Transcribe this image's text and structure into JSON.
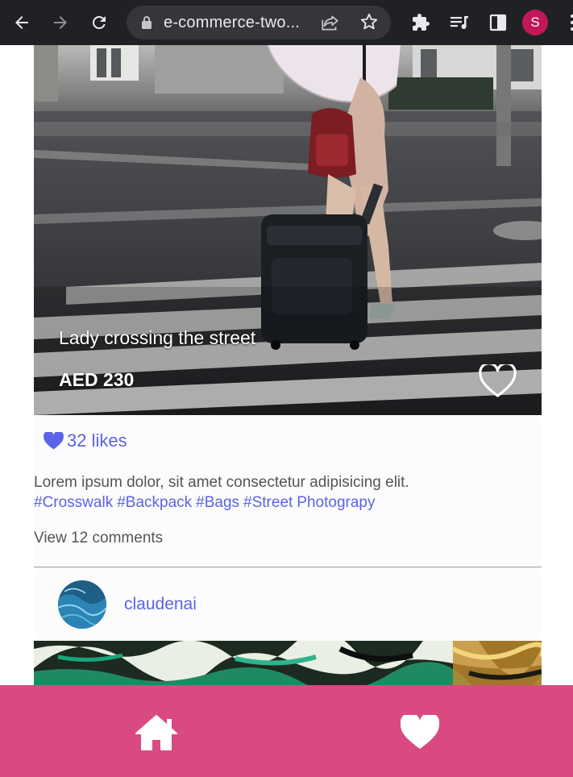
{
  "browser": {
    "url": "e-commerce-two...",
    "profile_initial": "S",
    "icons": [
      "back-arrow-icon",
      "forward-arrow-icon",
      "reload-icon",
      "lock-icon",
      "share-icon",
      "bookmark-star-icon",
      "extensions-puzzle-icon",
      "media-playlist-icon",
      "side-panel-icon",
      "menu-dots-icon"
    ]
  },
  "post1": {
    "title": "Lady crossing the street",
    "price": "AED 230",
    "likes": "32 likes",
    "description": "Lorem ipsum dolor, sit amet consectetur adipisicing elit.",
    "tags": [
      "#Crosswalk",
      "#Backpack",
      "#Bags",
      "#Street",
      "Photograpy"
    ],
    "comments_link": "View 12 comments"
  },
  "post2": {
    "username": "claudenai"
  },
  "bottom_nav": {
    "items": [
      "home-icon",
      "heart-icon"
    ]
  },
  "colors": {
    "accent": "#5b63e6",
    "nav_bg": "#d94a82",
    "browser_bg": "#202124",
    "avatar_bg": "#c2185b"
  }
}
